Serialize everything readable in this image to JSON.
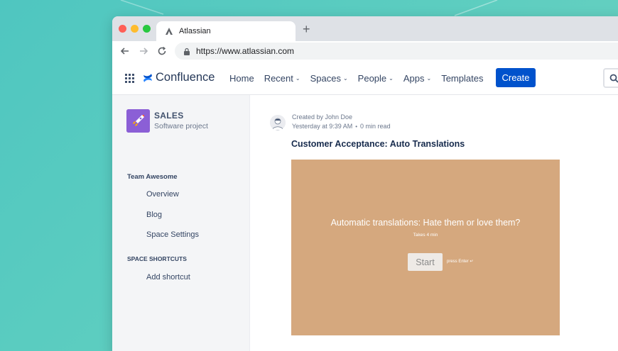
{
  "browser": {
    "tab_title": "Atlassian",
    "new_tab": "+",
    "url": "https://www.atlassian.com"
  },
  "confluence_nav": {
    "brand": "Confluence",
    "menu": [
      {
        "label": "Home",
        "has_dropdown": false
      },
      {
        "label": "Recent",
        "has_dropdown": true
      },
      {
        "label": "Spaces",
        "has_dropdown": true
      },
      {
        "label": "People",
        "has_dropdown": true
      },
      {
        "label": "Apps",
        "has_dropdown": true
      },
      {
        "label": "Templates",
        "has_dropdown": false
      }
    ],
    "create_label": "Create"
  },
  "sidebar": {
    "space_name": "SALES",
    "space_type": "Software project",
    "team_heading": "Team Awesome",
    "links": [
      "Overview",
      "Blog",
      "Space Settings"
    ],
    "shortcuts_heading": "SPACE SHORTCUTS",
    "add_shortcut": "Add shortcut"
  },
  "page": {
    "created_by": "Created by John Doe",
    "timestamp": "Yesterday at 9:39 AM",
    "read_time": "0 min read",
    "title": "Customer Acceptance: Auto Translations"
  },
  "embed": {
    "question": "Automatic translations: Hate them or love them?",
    "duration": "Takes 4 min",
    "start_label": "Start",
    "hint": "press Enter ↵"
  },
  "colors": {
    "background": "#5ccdc0",
    "create_button": "#0052cc",
    "embed_background": "#d5a87e",
    "space_avatar": "#8b5fd6"
  }
}
